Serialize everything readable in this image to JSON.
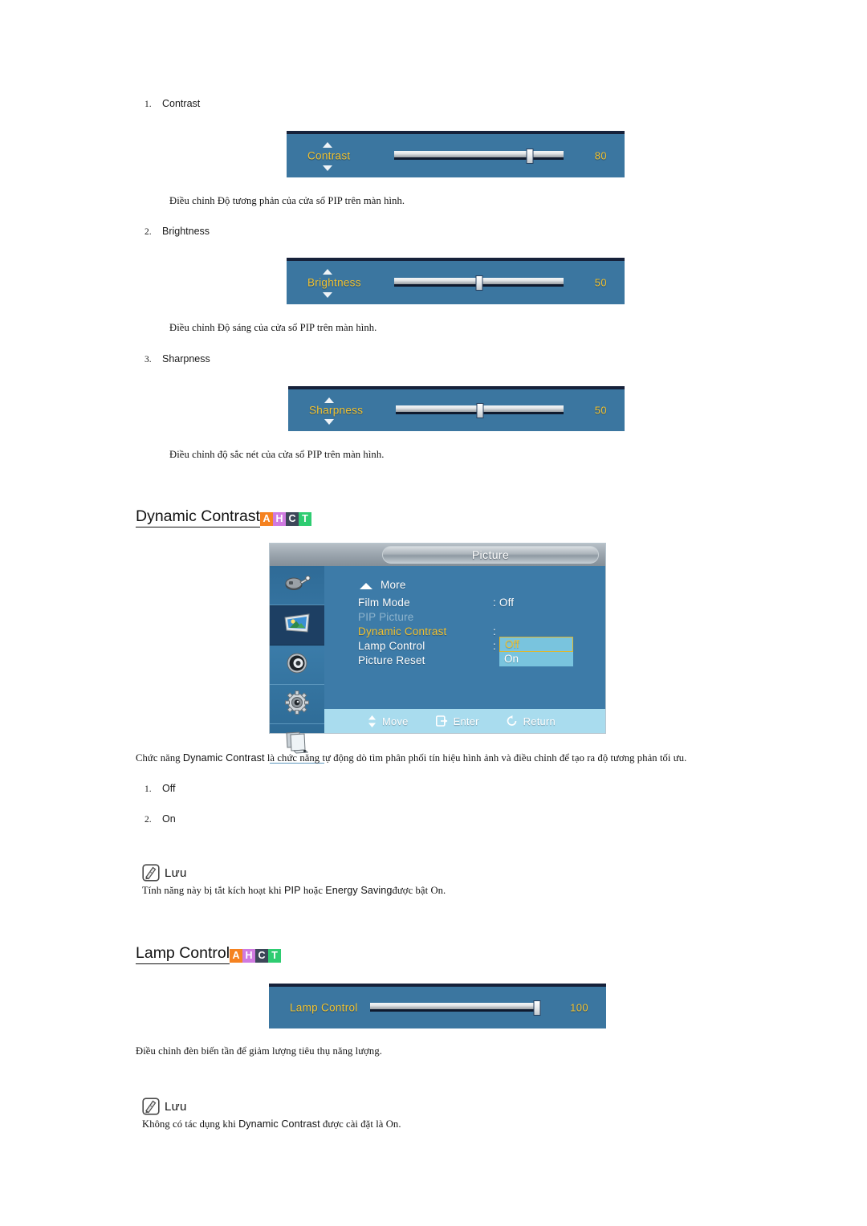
{
  "colors": {
    "badge_a": "#f58220",
    "badge_h": "#cf7ae0",
    "badge_c": "#3d4759",
    "badge_t": "#2ecc71",
    "osd_blue": "#3d7ba8",
    "slider_blue": "#3b76a0",
    "osd_accent_yellow": "#f2c230",
    "osd_highlight": "#79c4de"
  },
  "items": [
    {
      "number": "1.",
      "label": "Contrast",
      "slider": {
        "label": "Contrast",
        "value": "80",
        "percent": 80
      },
      "description": "Điều chỉnh Độ tương phản của cửa sổ PIP trên màn hình."
    },
    {
      "number": "2.",
      "label": "Brightness",
      "slider": {
        "label": "Brightness",
        "value": "50",
        "percent": 50
      },
      "description": "Điều chỉnh Độ sáng của cửa sổ PIP trên màn hình."
    },
    {
      "number": "3.",
      "label": "Sharpness",
      "slider": {
        "label": "Sharpness",
        "value": "50",
        "percent": 50
      },
      "description": "Điều chỉnh độ sắc nét của cửa sổ PIP trên màn hình."
    }
  ],
  "dynamic_contrast": {
    "heading": "Dynamic Contrast",
    "badges": [
      "A",
      "H",
      "C",
      "T"
    ],
    "osd": {
      "title": "Picture",
      "sidebar_icons": [
        "input-source-icon",
        "picture-icon",
        "sound-icon",
        "setup-gear-icon",
        "multi-control-icon"
      ],
      "selected_sidebar_index": 1,
      "rows": [
        {
          "label": "More",
          "value": "",
          "state": "more"
        },
        {
          "label": "Film Mode",
          "value": ": Off",
          "state": "normal"
        },
        {
          "label": "PIP Picture",
          "value": "",
          "state": "disabled"
        },
        {
          "label": "Dynamic Contrast",
          "value": ":",
          "state": "active"
        },
        {
          "label": "Lamp Control",
          "value": ":",
          "state": "normal"
        },
        {
          "label": "Picture Reset",
          "value": "",
          "state": "normal"
        }
      ],
      "dropdown": {
        "options": [
          "Off",
          "On"
        ],
        "selected": "Off"
      },
      "footer": [
        {
          "icon": "updown-arrows-icon",
          "label": "Move"
        },
        {
          "icon": "enter-icon",
          "label": "Enter"
        },
        {
          "icon": "return-icon",
          "label": "Return"
        }
      ]
    },
    "paragraph_prefix": "Chức năng ",
    "paragraph_en": "Dynamic Contrast",
    "paragraph_suffix": " là chức năng tự động dò tìm phân phối tín hiệu hình ảnh và điều chỉnh để tạo ra độ tương phản tối ưu.",
    "options": [
      {
        "number": "1.",
        "label": "Off"
      },
      {
        "number": "2.",
        "label": "On"
      }
    ],
    "note": {
      "icon": "note-pencil-icon",
      "label": "Lưu",
      "text_prefix": "Tính năng này bị tắt kích hoạt khi ",
      "text_en1": "PIP",
      "text_mid": " hoặc ",
      "text_en2": "Energy Saving",
      "text_suffix": "được bật On."
    }
  },
  "lamp_control": {
    "heading": "Lamp Control",
    "badges": [
      "A",
      "H",
      "C",
      "T"
    ],
    "slider": {
      "label": "Lamp Control",
      "value": "100",
      "percent": 100
    },
    "description": "Điều chỉnh đèn biến tần để giảm lượng tiêu thụ năng lượng.",
    "note": {
      "icon": "note-pencil-icon",
      "label": "Lưu",
      "text_prefix": "Không có tác dụng khi ",
      "text_en": "Dynamic Contrast",
      "text_suffix": " được cài đặt là On."
    }
  }
}
